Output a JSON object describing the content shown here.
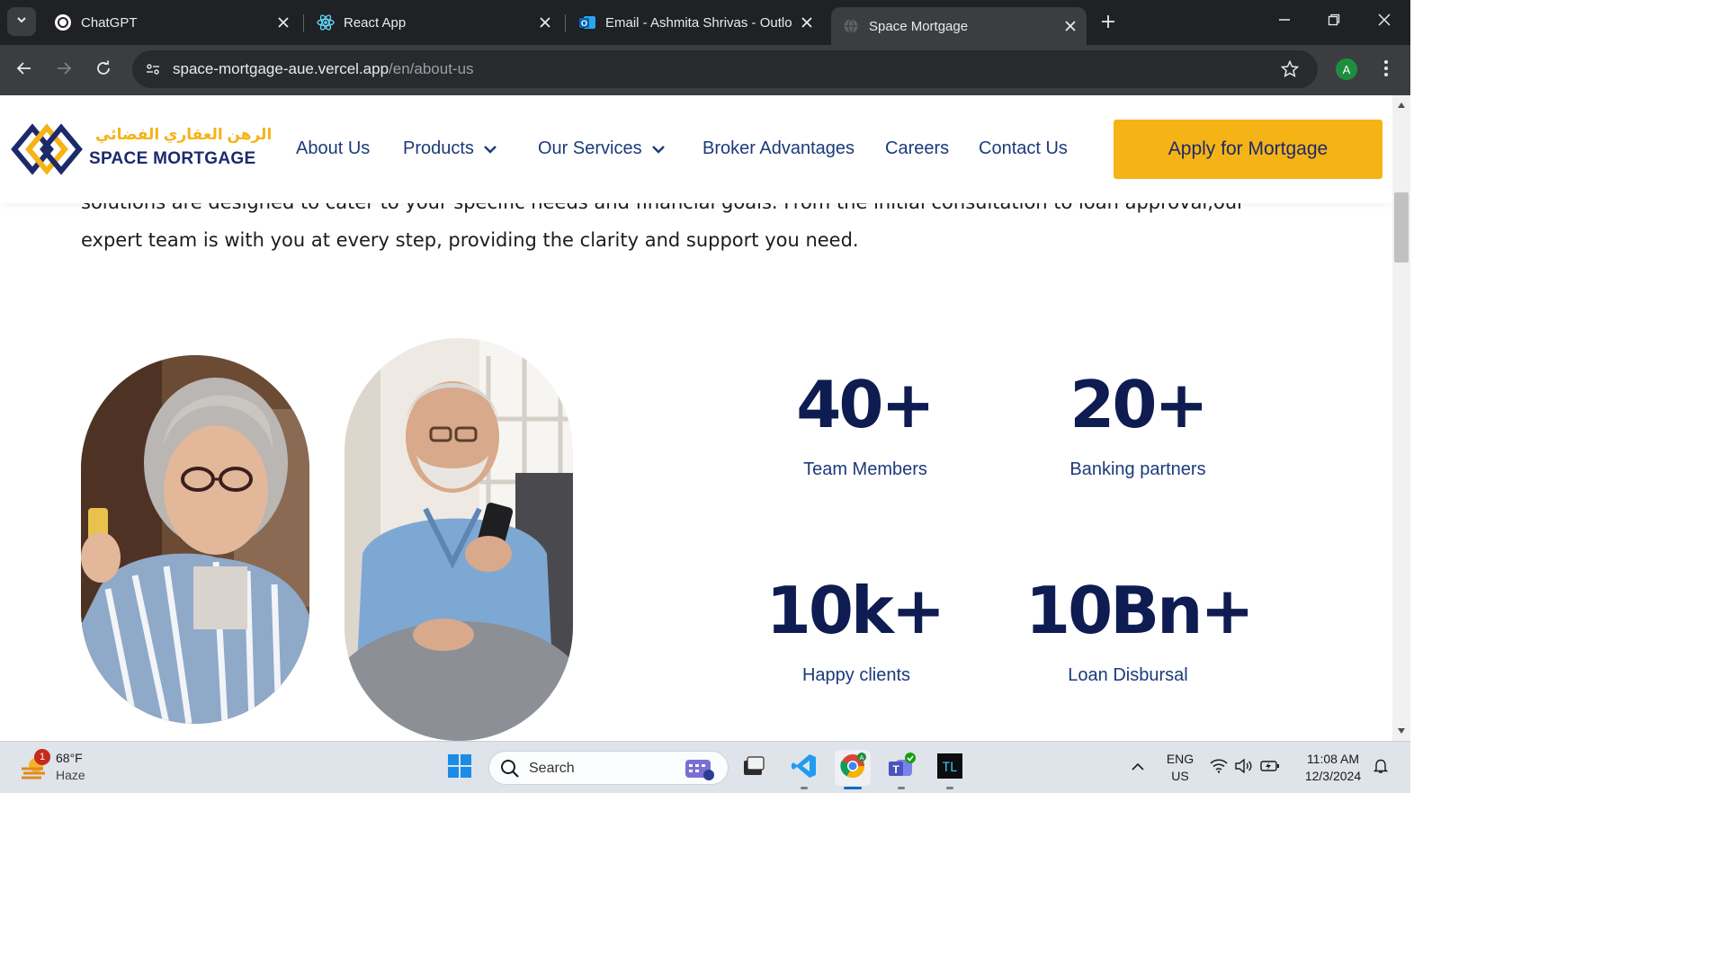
{
  "browser": {
    "tabs": [
      {
        "title": "ChatGPT",
        "icon": "chatgpt-icon"
      },
      {
        "title": "React App",
        "icon": "react-icon"
      },
      {
        "title": "Email - Ashmita Shrivas - Outlo",
        "icon": "outlook-icon"
      },
      {
        "title": "Space Mortgage",
        "icon": "globe-icon",
        "active": true
      }
    ],
    "url_host": "space-mortgage-aue.vercel.app",
    "url_path": "/en/about-us",
    "profile_initial": "A"
  },
  "site": {
    "logo_arabic": "الرهن العقاري الفضائي",
    "logo_english": "SPACE MORTGAGE",
    "nav": {
      "about": "About Us",
      "products": "Products",
      "services": "Our Services",
      "broker": "Broker Advantages",
      "careers": "Careers",
      "contact": "Contact Us"
    },
    "apply_label": "Apply for Mortgage",
    "intro_text": "solutions are designed to cater to your specific needs and financial goals. From the initial consultation to loan approval,our expert team is with you at every step, providing the clarity and support you need.",
    "stats": [
      {
        "value": "40+",
        "label": "Team Members"
      },
      {
        "value": "20+",
        "label": "Banking partners"
      },
      {
        "value": "10k+",
        "label": "Happy clients"
      },
      {
        "value": "10Bn+",
        "label": "Loan Disbursal"
      }
    ],
    "colors": {
      "brand_navy": "#0e1c52",
      "brand_yellow": "#f5b316",
      "nav_text": "#1c3a7a"
    }
  },
  "taskbar": {
    "weather_temp": "68°F",
    "weather_cond": "Haze",
    "weather_badge": "1",
    "search_label": "Search",
    "lang_line1": "ENG",
    "lang_line2": "US",
    "time": "11:08 AM",
    "date": "12/3/2024"
  }
}
